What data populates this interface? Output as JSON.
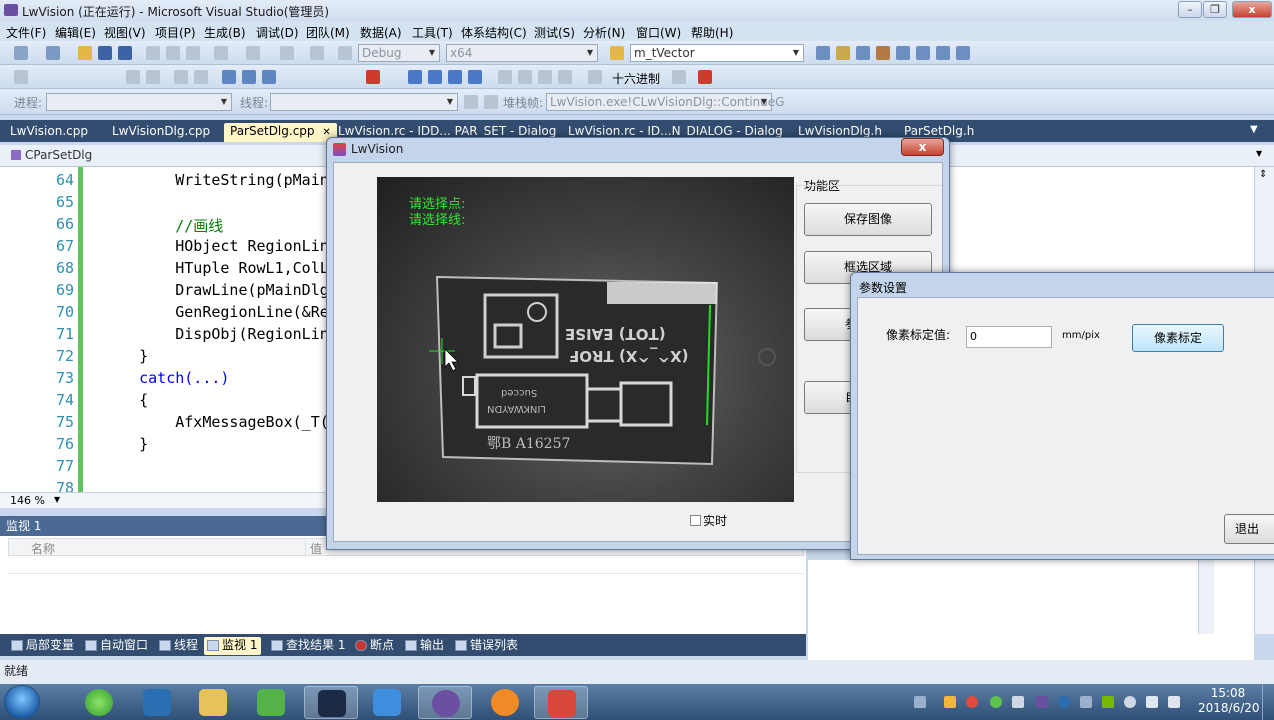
{
  "vs": {
    "title": "LwVision (正在运行) - Microsoft Visual Studio(管理员)",
    "menu": [
      "文件(F)",
      "编辑(E)",
      "视图(V)",
      "项目(P)",
      "生成(B)",
      "调试(D)",
      "团队(M)",
      "数据(A)",
      "工具(T)",
      "体系结构(C)",
      "测试(S)",
      "分析(N)",
      "窗口(W)",
      "帮助(H)"
    ],
    "toolbar": {
      "config": "Debug",
      "platform": "x64",
      "find_value": "m_tVector",
      "hex_label": "十六进制",
      "process_label": "进程:",
      "thread_label": "线程:",
      "stack_label": "堆栈帧:",
      "stack_value": "LwVision.exe!CLwVisionDlg::ContinueG"
    },
    "tabs": [
      "LwVision.cpp",
      "LwVisionDlg.cpp",
      "ParSetDlg.cpp",
      "LwVision.rc - IDD... PAR_SET - Dialog",
      "LwVision.rc - ID...N_DIALOG - Dialog",
      "LwVisionDlg.h",
      "ParSetDlg.h"
    ],
    "class_combo": "CParSetDlg",
    "code_lines": [
      {
        "num": "64",
        "text": "        WriteString(pMain",
        "kind": "code"
      },
      {
        "num": "65",
        "text": "",
        "kind": "code"
      },
      {
        "num": "66",
        "text": "        //画线",
        "kind": "comment"
      },
      {
        "num": "67",
        "text": "        HObject RegionLin",
        "kind": "code"
      },
      {
        "num": "68",
        "text": "        HTuple RowL1,ColL",
        "kind": "code"
      },
      {
        "num": "69",
        "text": "        DrawLine(pMainDlg",
        "kind": "code"
      },
      {
        "num": "70",
        "text": "        GenRegionLine(&Re",
        "kind": "code"
      },
      {
        "num": "71",
        "text": "        DispObj(RegionLin",
        "kind": "code"
      },
      {
        "num": "72",
        "text": "    }",
        "kind": "code"
      },
      {
        "num": "73",
        "text": "    catch(...)",
        "kind": "keyword"
      },
      {
        "num": "74",
        "text": "    {",
        "kind": "code"
      },
      {
        "num": "75",
        "text": "        AfxMessageBox(_T(",
        "kind": "code"
      },
      {
        "num": "76",
        "text": "    }",
        "kind": "code"
      },
      {
        "num": "77",
        "text": "",
        "kind": "code"
      },
      {
        "num": "78",
        "text": "",
        "kind": "code"
      }
    ],
    "zoom": "146 %",
    "watch": {
      "title": "监视 1",
      "col_name": "名称",
      "col_value": "值"
    },
    "bottom_tabs": [
      "局部变量",
      "自动窗口",
      "线程",
      "监视 1",
      "查找结果 1",
      "断点",
      "输出",
      "错误列表"
    ],
    "status": "就绪"
  },
  "dialog_main": {
    "title": "LwVision",
    "close": "x",
    "overlay_text": [
      "请选择点:",
      "请选择线:"
    ],
    "function_group": "功能区",
    "buttons": [
      "保存图像",
      "框选区域",
      "参",
      "自"
    ],
    "realtime_label": "实时",
    "image_text": [
      "(TOT) EAISE",
      "(X^_^X) TROF",
      "LINKWAYDN",
      "Succed",
      "鄂B A16257"
    ],
    "colors": {
      "overlay_green": "#2ee82e",
      "crosshair": "#22dd22"
    }
  },
  "dialog_param": {
    "title": "参数设置",
    "field_label": "像素标定值:",
    "field_value": "0",
    "unit": "mm/pix",
    "calibrate_button": "像素标定",
    "exit_button": "退出"
  },
  "taskbar": {
    "time": "15:08",
    "date": "2018/6/20",
    "apps": [
      "start-orb",
      "360-browser",
      "camera-app",
      "file-explorer",
      "notepad-app",
      "visual-studio",
      "wps-writer",
      "vs-project",
      "halcon",
      "paint-app"
    ]
  }
}
